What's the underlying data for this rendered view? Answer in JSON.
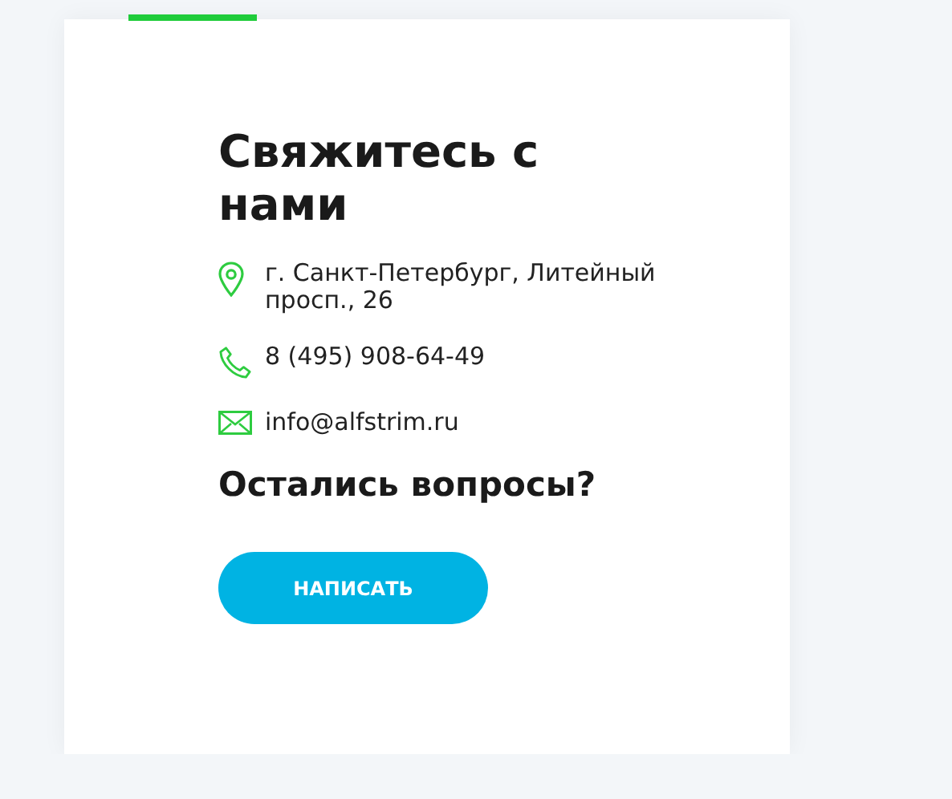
{
  "title": "Свяжитесь с нами",
  "contacts": [
    {
      "kind": "address",
      "text": "г. Санкт-Петербург, Литейный просп., 26"
    },
    {
      "kind": "phone",
      "text": "8 (495) 908-64-49"
    },
    {
      "kind": "email",
      "text": "info@alfstrim.ru"
    }
  ],
  "subtitle": "Остались вопросы?",
  "button": "НАПИСАТЬ"
}
